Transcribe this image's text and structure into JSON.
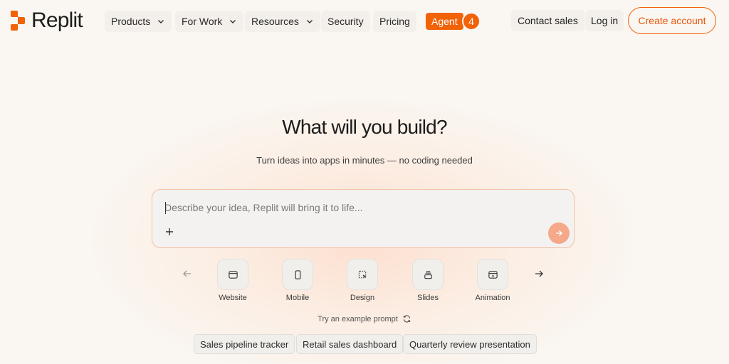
{
  "brand": {
    "name": "Replit",
    "accent": "#f26207"
  },
  "nav": {
    "products": "Products",
    "for_work": "For Work",
    "resources": "Resources",
    "security": "Security",
    "pricing": "Pricing",
    "agent": "Agent",
    "agent_badge": "4",
    "contact_sales": "Contact sales",
    "login": "Log in",
    "create_account": "Create account"
  },
  "hero": {
    "title": "What will you build?",
    "subtitle": "Turn ideas into apps in minutes — no coding needed",
    "prompt_placeholder": "Describe your idea, Replit will bring it to life..."
  },
  "categories": [
    {
      "label": "Website",
      "icon": "browser-window-icon"
    },
    {
      "label": "Mobile",
      "icon": "phone-icon"
    },
    {
      "label": "Design",
      "icon": "cursor-select-icon"
    },
    {
      "label": "Slides",
      "icon": "stack-icon"
    },
    {
      "label": "Animation",
      "icon": "play-window-icon"
    }
  ],
  "examples": {
    "label": "Try an example prompt",
    "chips": [
      "Sales pipeline tracker",
      "Retail sales dashboard",
      "Quarterly review presentation"
    ]
  }
}
